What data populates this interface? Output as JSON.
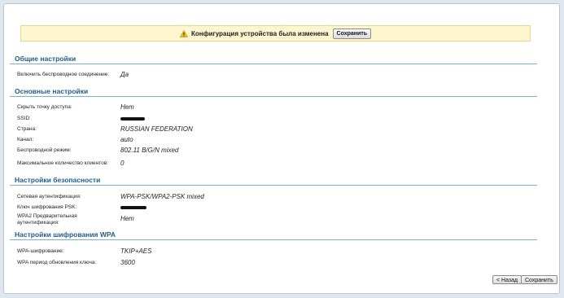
{
  "notice": {
    "text": "Конфигурация устройства была изменена",
    "save_label": "Сохранить",
    "icon": "warning-icon"
  },
  "sections": {
    "general": {
      "title": "Общие настройки",
      "rows": [
        {
          "label": "Включить беспроводное соединение:",
          "value": "Да"
        }
      ]
    },
    "basic": {
      "title": "Основные настройки",
      "rows": [
        {
          "label": "Скрыть точку доступа:",
          "value": "Нет"
        },
        {
          "label": "SSID:",
          "value": ""
        },
        {
          "label": "Страна:",
          "value": "RUSSIAN FEDERATION"
        },
        {
          "label": "Канал:",
          "value": "auto"
        },
        {
          "label": "Беспроводной режим:",
          "value": "802.11 B/G/N mixed"
        },
        {
          "label": "Максимальное количество клиентов:",
          "value": "0"
        }
      ]
    },
    "security": {
      "title": "Настройки безопасности",
      "rows": [
        {
          "label": "Сетевая аутентификация:",
          "value": "WPA-PSK/WPA2-PSK mixed"
        },
        {
          "label": "Ключ шифрования PSK:",
          "value": ""
        },
        {
          "label": "WPA2 Предварительная аутентификация:",
          "value": "Нет"
        }
      ]
    },
    "wpa": {
      "title": "Настройки шифрования WPA",
      "rows": [
        {
          "label": "WPA-шифрование:",
          "value": "TKIP+AES"
        },
        {
          "label": "WPA период обновления ключа:",
          "value": "3600"
        }
      ]
    }
  },
  "footer": {
    "back_label": "< Назад",
    "save_label": "Сохранить"
  }
}
